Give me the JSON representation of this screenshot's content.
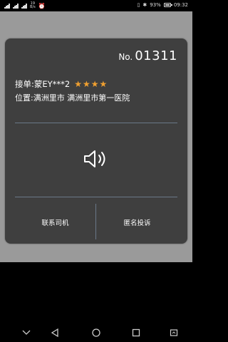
{
  "status_bar": {
    "network_speed_value": "19",
    "network_speed_unit": "B/s",
    "battery": "93%",
    "time": "09:32"
  },
  "card": {
    "order_prefix": "No.",
    "order_number": "01311",
    "pickup_label": "接单:蒙EY***2",
    "rating_stars": 4,
    "location_label": "位置:满洲里市 满洲里市第一医院",
    "contact_driver_label": "联系司机",
    "anonymous_complaint_label": "匿名投诉"
  },
  "icons": {
    "speaker": "speaker-icon",
    "star_color": "#f0a030"
  }
}
